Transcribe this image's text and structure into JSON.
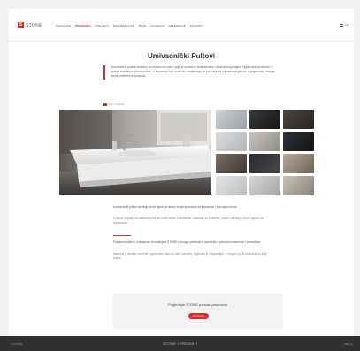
{
  "brand": {
    "logo_mark": "S",
    "name": "STONE",
    "accent": "#d92b2b"
  },
  "nav": {
    "items": [
      {
        "label": "NASLOVNA",
        "active": false
      },
      {
        "label": "PROIZVODI",
        "active": true
      },
      {
        "label": "PROJEKTI",
        "active": false
      },
      {
        "label": "NAMJEŠTAJ OD",
        "active": false
      },
      {
        "label": "BOJE",
        "active": false
      },
      {
        "label": "GALERIJA",
        "active": false
      },
      {
        "label": "REFERENCE",
        "active": false
      },
      {
        "label": "KONTAKT",
        "active": false
      }
    ],
    "language": "HR"
  },
  "page": {
    "title": "Umivaonički Pultovi",
    "intro": "Umivaonički pultovi izrađuju se upravo po mjeri, gdje je potrebno funkcionalno, estetski dugotrajno. Higijenske prednosti, u sadnje kvalitetno gotovi pultovi, u kupaonici koji nude dio namještaja za područje uz ispravnu trajnicom u potpunosti, mnoge razne preference prostora.",
    "gallery_label": "Foto Galerija",
    "paragraphs": [
      "Umivaonički pultovi izrađuju se do mjere po izboru svojih proizvoda za kupaonice i sve radne plohe.",
      "U izboru bojanja i kombiniranja sa bilo kojim stilom umivaonika, materijali su kvalitetni, otporni na vlagu, trajni i ugodni za održavanje.",
      "Popularni pultovi i umivaonici od materijala STONE s mnogo prednosti u usporedbi s prirodnim kamenom i keramikom.",
      "Materijal je otporan na mrlje i ogrebotine, lako se čisti i održava, higijenski je i dugotrajan, a moguće ga je oblikovati po želji kupca."
    ]
  },
  "cta": {
    "title": "Pogledajte STONE ponudu proizvoda",
    "button": "Proizvodi"
  },
  "footer": {
    "left": "© STONE",
    "center": "ISTONE + PROJEKTI",
    "right": "Web by"
  }
}
